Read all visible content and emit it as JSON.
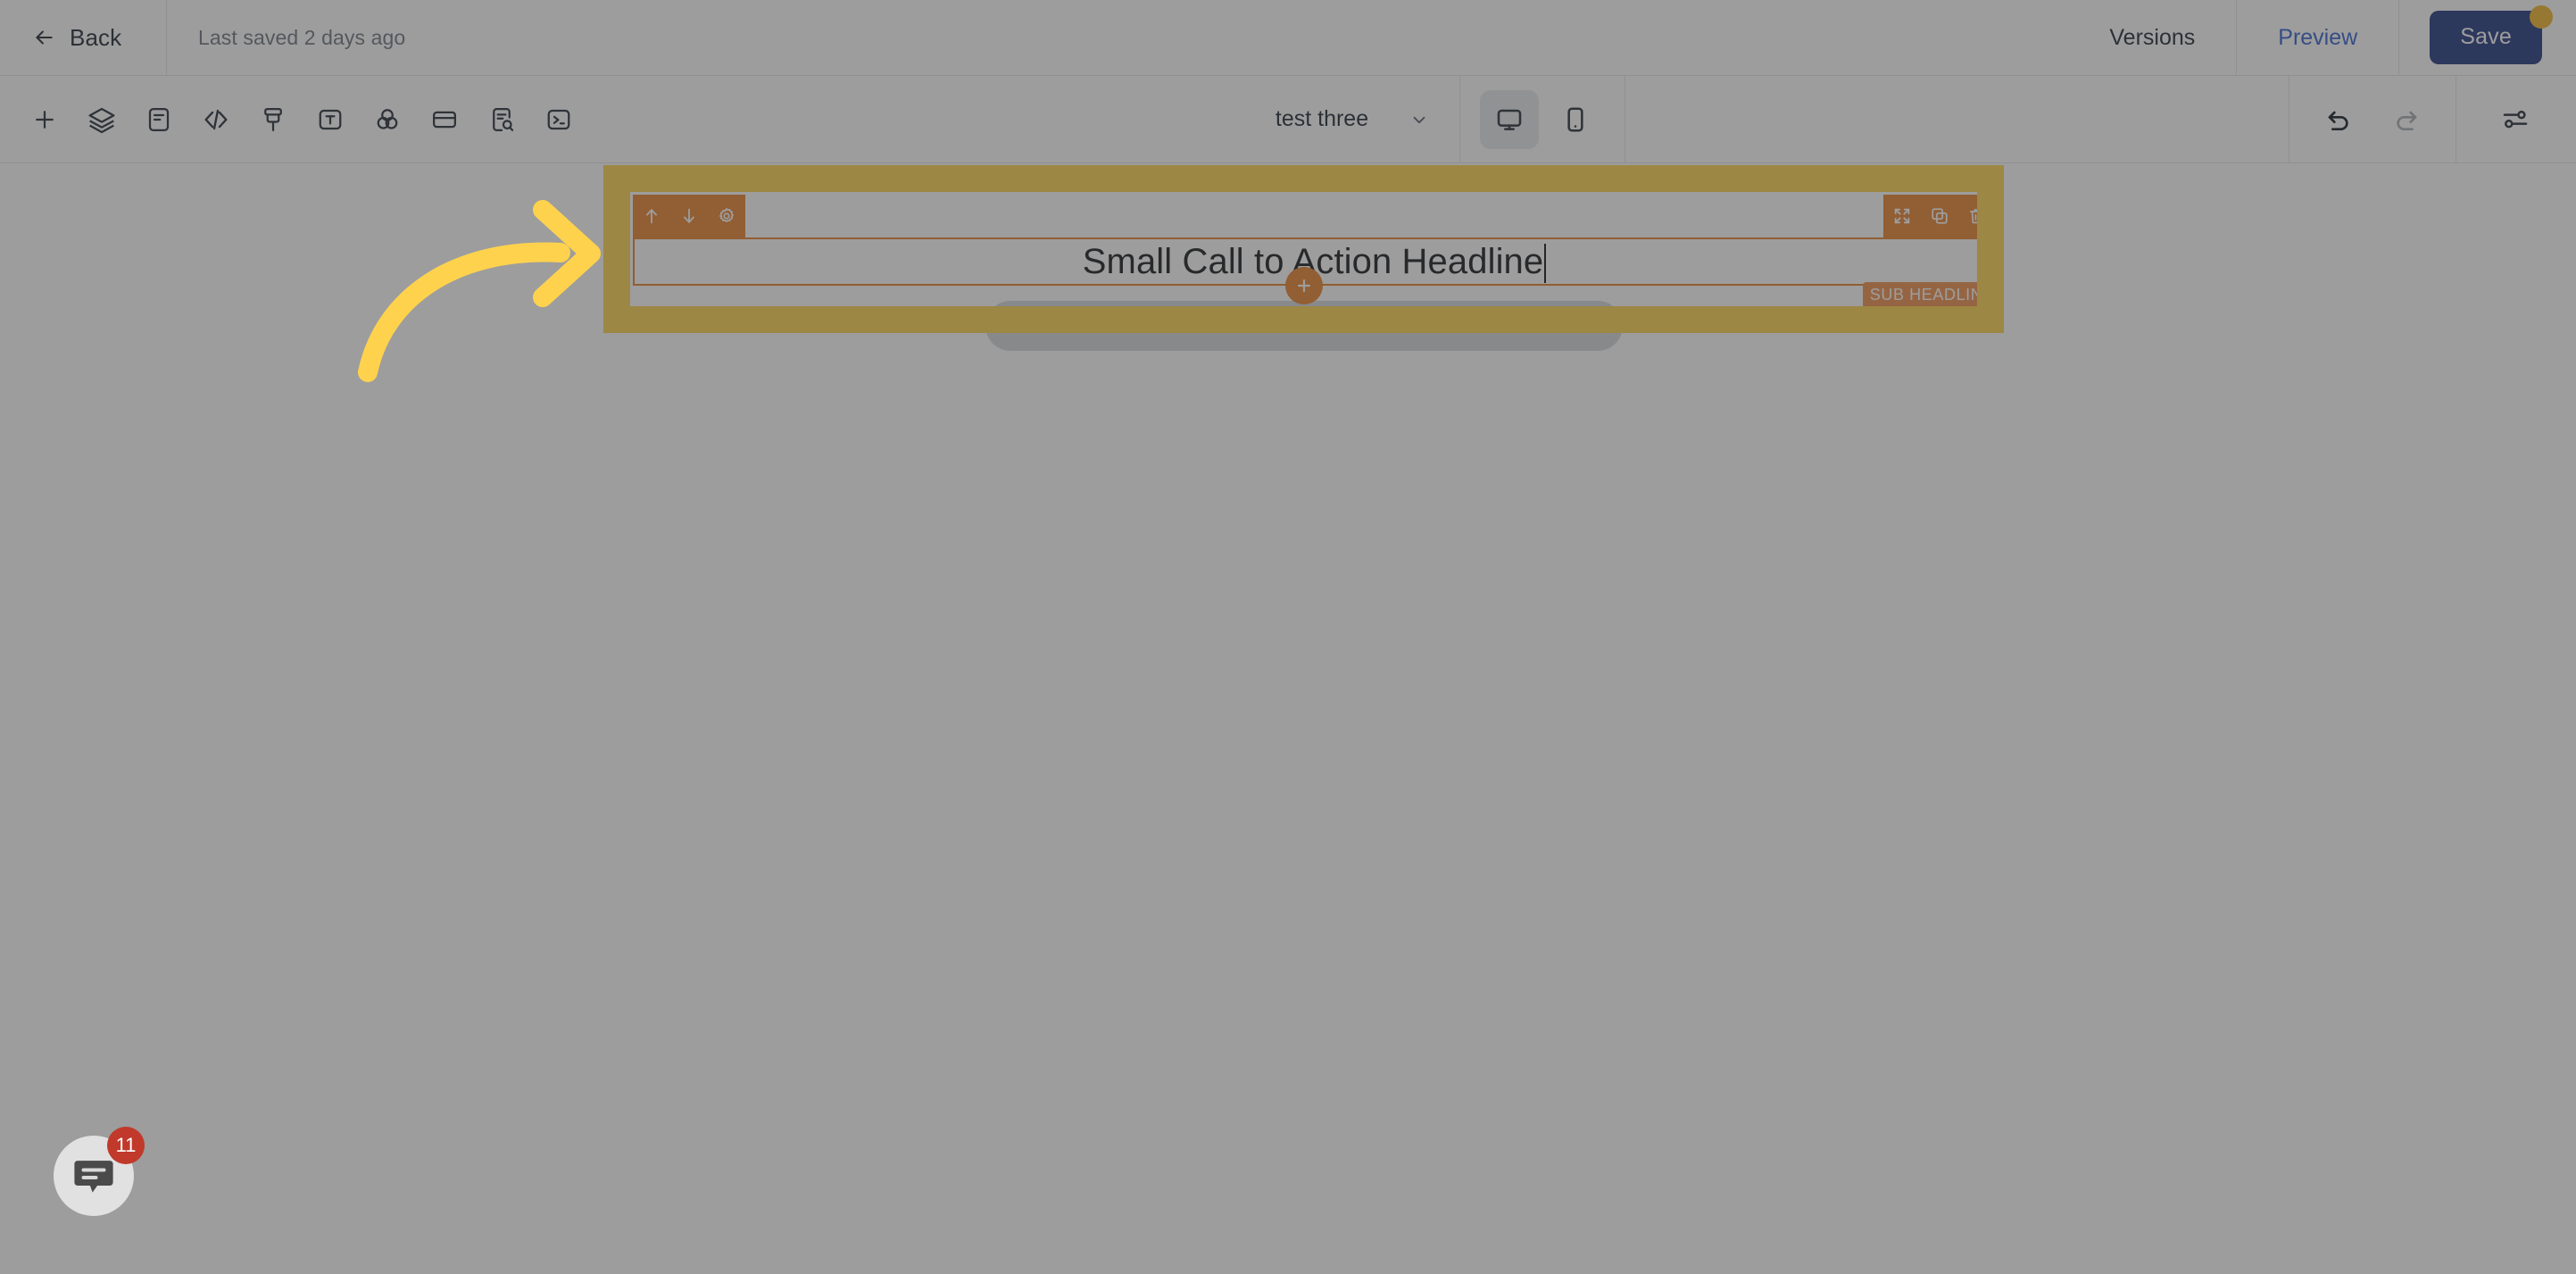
{
  "topbar": {
    "back_label": "Back",
    "back_icon": "arrow-left-icon",
    "saved_status": "Last saved 2 days ago",
    "versions_label": "Versions",
    "preview_label": "Preview",
    "save_label": "Save",
    "save_badge_color": "#f0b429",
    "preview_color": "#2f5fd0",
    "save_bg_color": "#1e357f"
  },
  "toolbar": {
    "tools": [
      {
        "name": "add-icon",
        "title": "Add"
      },
      {
        "name": "layers-icon",
        "title": "Layers"
      },
      {
        "name": "document-icon",
        "title": "Content"
      },
      {
        "name": "code-icon",
        "title": "Code"
      },
      {
        "name": "brush-icon",
        "title": "Style"
      },
      {
        "name": "text-box-icon",
        "title": "Text"
      },
      {
        "name": "color-circles-icon",
        "title": "Colors"
      },
      {
        "name": "card-icon",
        "title": "Card"
      },
      {
        "name": "document-search-icon",
        "title": "SEO"
      },
      {
        "name": "terminal-icon",
        "title": "Console"
      }
    ],
    "page_select": {
      "value": "test three",
      "chevron_icon": "chevron-down-icon"
    },
    "devices": [
      {
        "name": "desktop-icon",
        "label": "Desktop",
        "active": true
      },
      {
        "name": "mobile-icon",
        "label": "Mobile",
        "active": false
      }
    ],
    "history": [
      {
        "name": "undo-icon",
        "label": "Undo",
        "enabled": true
      },
      {
        "name": "redo-icon",
        "label": "Redo",
        "enabled": false
      }
    ],
    "settings_icon": "sliders-icon"
  },
  "canvas": {
    "section": {
      "left_tools": [
        {
          "name": "move-up-icon",
          "label": "Move up"
        },
        {
          "name": "move-down-icon",
          "label": "Move down"
        },
        {
          "name": "gear-icon",
          "label": "Settings"
        }
      ],
      "right_tools": [
        {
          "name": "expand-icon",
          "label": "Expand"
        },
        {
          "name": "duplicate-icon",
          "label": "Duplicate"
        },
        {
          "name": "trash-icon",
          "label": "Delete"
        }
      ],
      "headline_value": "Small Call to Action Headline",
      "sub_headline_tag": "SUB HEADLINE",
      "add_block_icon": "plus-circle-icon",
      "cta_button_placeholder": "",
      "highlight_color": "#ffd24d",
      "accent_color": "#e8802a",
      "tag_color": "#ef8f4a"
    },
    "annotation": {
      "name": "curved-arrow-annotation",
      "color": "#ffd24d"
    }
  },
  "chat": {
    "icon": "chat-bubble-icon",
    "badge_count": "11",
    "badge_color": "#c0392b"
  }
}
